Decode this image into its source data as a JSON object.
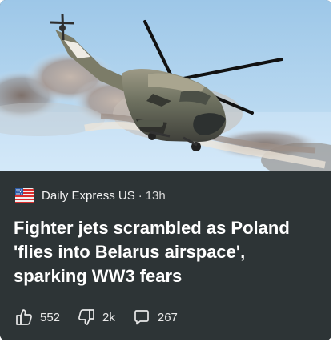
{
  "card": {
    "hero_image": "military-helicopter-firing-rockets",
    "source_logo_icon": "flag-logo-icon",
    "source": "Daily Express US",
    "separator": "·",
    "time": "13h",
    "title": "Fighter jets scrambled as Poland 'flies into Belarus airspace', sparking WW3 fears"
  },
  "actions": {
    "like_icon": "thumbs-up-icon",
    "like_count": "552",
    "dislike_icon": "thumbs-down-icon",
    "dislike_count": "2k",
    "comment_icon": "comment-icon",
    "comment_count": "267"
  },
  "colors": {
    "card_background": "#2d3436",
    "title_text": "#ffffff",
    "meta_text": "#f1f1f1"
  }
}
